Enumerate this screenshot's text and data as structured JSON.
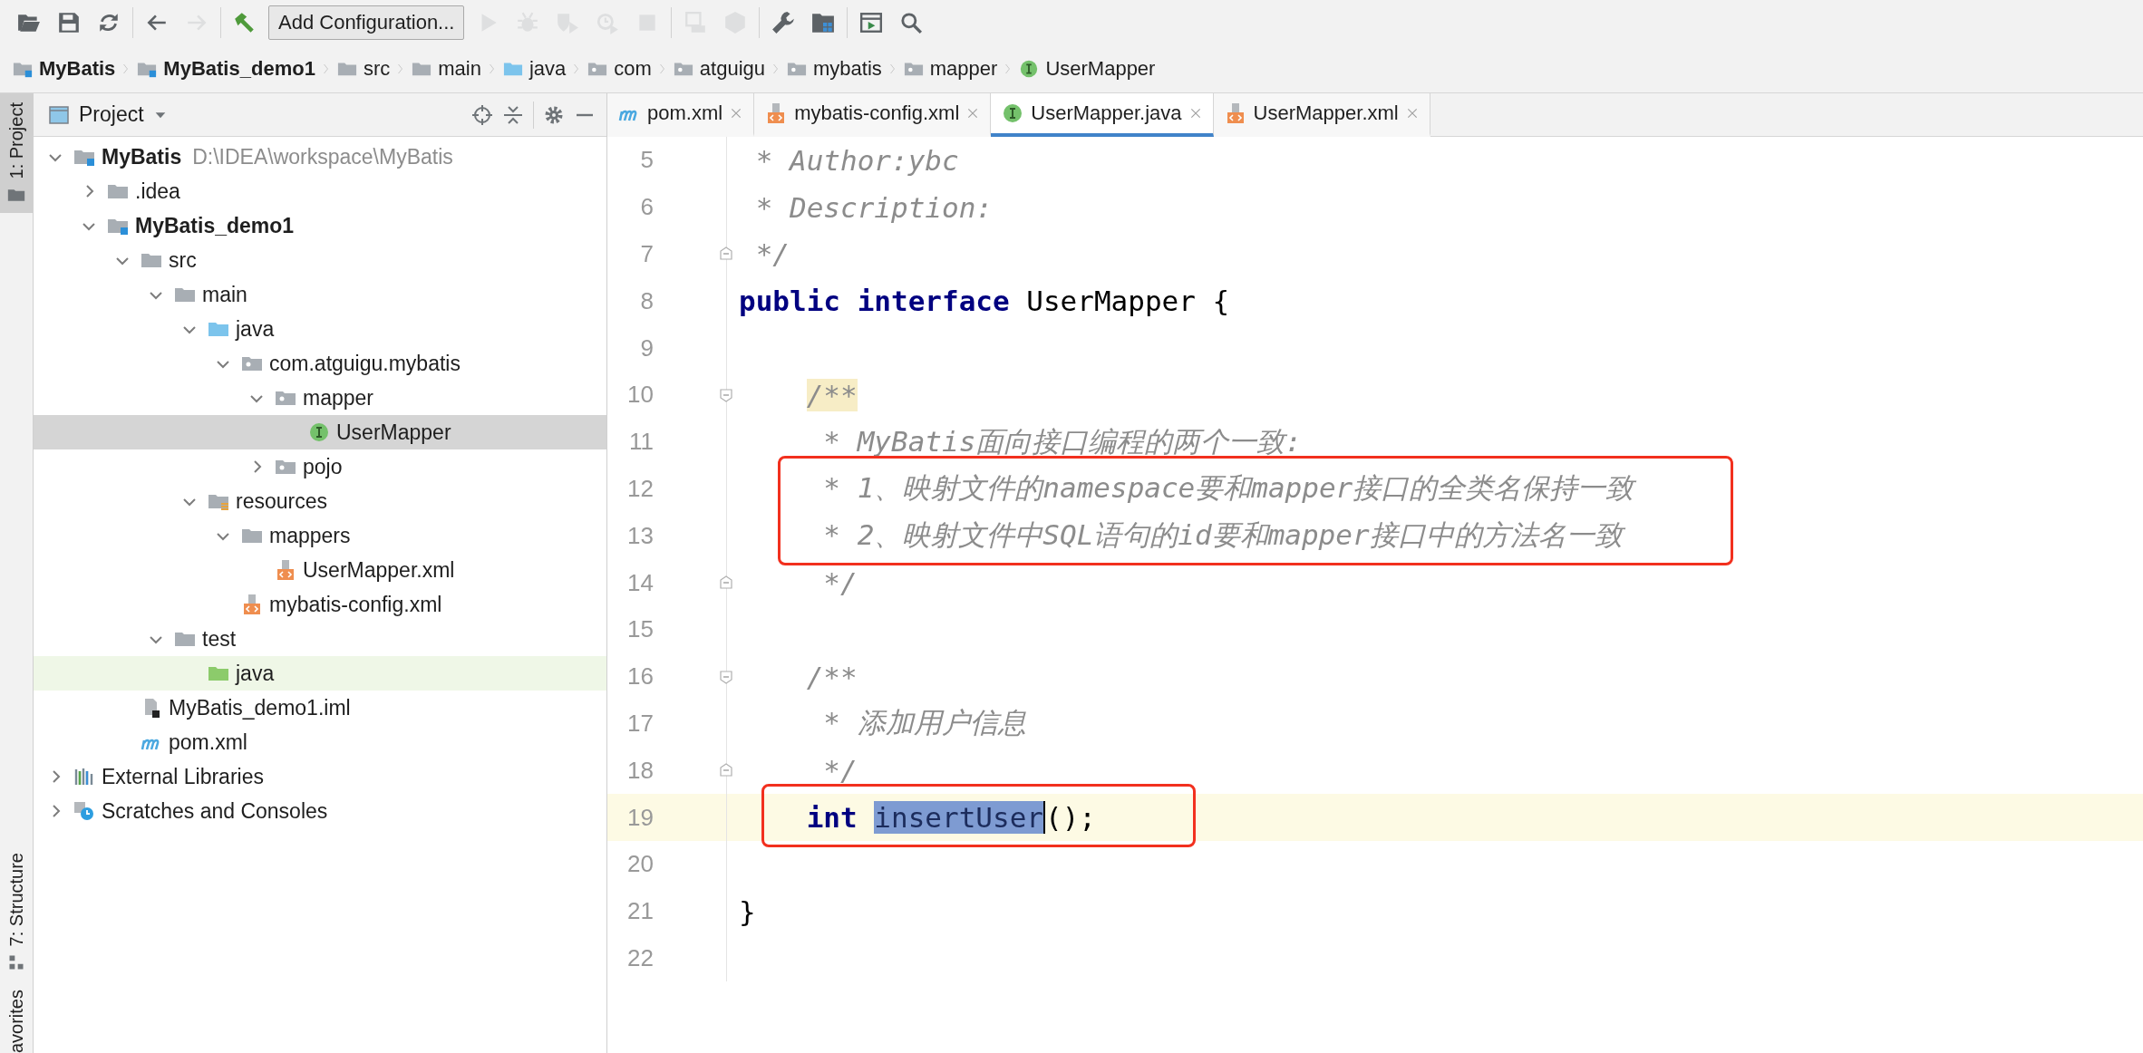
{
  "toolbar": {
    "groups": [
      [
        {
          "kind": "open",
          "disabled": false
        },
        {
          "kind": "save",
          "disabled": false
        },
        {
          "kind": "sync",
          "disabled": false
        }
      ],
      [
        {
          "kind": "back",
          "disabled": false
        },
        {
          "kind": "forward",
          "disabled": true
        }
      ],
      [
        {
          "kind": "build",
          "disabled": false
        },
        {
          "kind": "run_config",
          "label": "Add Configuration...",
          "disabled": false
        },
        {
          "kind": "run",
          "disabled": true
        },
        {
          "kind": "debug",
          "disabled": true
        },
        {
          "kind": "coverage",
          "disabled": true
        },
        {
          "kind": "profile",
          "disabled": true
        },
        {
          "kind": "stop",
          "disabled": true
        }
      ],
      [
        {
          "kind": "attach",
          "disabled": true
        },
        {
          "kind": "deploy",
          "disabled": true
        }
      ],
      [
        {
          "kind": "settings",
          "disabled": false
        },
        {
          "kind": "project_structure",
          "disabled": false
        }
      ],
      [
        {
          "kind": "frame",
          "disabled": false
        },
        {
          "kind": "search",
          "disabled": false
        }
      ]
    ]
  },
  "breadcrumbs": [
    {
      "label": "MyBatis",
      "kind": "module"
    },
    {
      "label": "MyBatis_demo1",
      "kind": "module"
    },
    {
      "label": "src",
      "kind": "folder"
    },
    {
      "label": "main",
      "kind": "folder"
    },
    {
      "label": "java",
      "kind": "source_folder"
    },
    {
      "label": "com",
      "kind": "package"
    },
    {
      "label": "atguigu",
      "kind": "package"
    },
    {
      "label": "mybatis",
      "kind": "package"
    },
    {
      "label": "mapper",
      "kind": "package"
    },
    {
      "label": "UserMapper",
      "kind": "interface"
    }
  ],
  "tool_stripe": [
    {
      "label": "1: Project",
      "kind": "project",
      "selected": true
    },
    {
      "label": "7: Structure",
      "kind": "structure",
      "selected": false
    },
    {
      "label": "avorites",
      "kind": "favorites",
      "selected": false
    }
  ],
  "project_panel": {
    "title": "Project",
    "tree": [
      {
        "label": "MyBatis",
        "path": "D:\\IDEA\\workspace\\MyBatis",
        "kind": "module",
        "expanded": true,
        "selected": false,
        "highlighted": false,
        "children": [
          {
            "label": ".idea",
            "kind": "folder",
            "expanded": false,
            "selected": false,
            "highlighted": false
          },
          {
            "label": "MyBatis_demo1",
            "kind": "module",
            "expanded": true,
            "selected": false,
            "highlighted": false,
            "children": [
              {
                "label": "src",
                "kind": "folder",
                "expanded": true,
                "selected": false,
                "highlighted": false,
                "children": [
                  {
                    "label": "main",
                    "kind": "folder",
                    "expanded": true,
                    "selected": false,
                    "highlighted": false,
                    "children": [
                      {
                        "label": "java",
                        "kind": "source_folder",
                        "expanded": true,
                        "selected": false,
                        "highlighted": false,
                        "children": [
                          {
                            "label": "com.atguigu.mybatis",
                            "kind": "package",
                            "expanded": true,
                            "selected": false,
                            "highlighted": false,
                            "children": [
                              {
                                "label": "mapper",
                                "kind": "package",
                                "expanded": true,
                                "selected": false,
                                "highlighted": false,
                                "children": [
                                  {
                                    "label": "UserMapper",
                                    "kind": "interface",
                                    "selected": true,
                                    "highlighted": false
                                  }
                                ]
                              },
                              {
                                "label": "pojo",
                                "kind": "package",
                                "expanded": false,
                                "selected": false,
                                "highlighted": false
                              }
                            ]
                          }
                        ]
                      },
                      {
                        "label": "resources",
                        "kind": "resources",
                        "expanded": true,
                        "selected": false,
                        "highlighted": false,
                        "children": [
                          {
                            "label": "mappers",
                            "kind": "folder",
                            "expanded": true,
                            "selected": false,
                            "highlighted": false,
                            "children": [
                              {
                                "label": "UserMapper.xml",
                                "kind": "xml",
                                "selected": false,
                                "highlighted": false
                              }
                            ]
                          },
                          {
                            "label": "mybatis-config.xml",
                            "kind": "xml",
                            "selected": false,
                            "highlighted": false
                          }
                        ]
                      }
                    ]
                  },
                  {
                    "label": "test",
                    "kind": "folder",
                    "expanded": true,
                    "selected": false,
                    "highlighted": false,
                    "children": [
                      {
                        "label": "java",
                        "kind": "test_folder",
                        "selected": false,
                        "highlighted": true
                      }
                    ]
                  }
                ]
              },
              {
                "label": "MyBatis_demo1.iml",
                "kind": "iml",
                "selected": false,
                "highlighted": false
              },
              {
                "label": "pom.xml",
                "kind": "maven",
                "selected": false,
                "highlighted": false
              }
            ]
          }
        ]
      },
      {
        "label": "External Libraries",
        "kind": "libraries",
        "expanded": false,
        "selected": false,
        "highlighted": false
      },
      {
        "label": "Scratches and Consoles",
        "kind": "scratches",
        "expanded": false,
        "selected": false,
        "highlighted": false
      }
    ]
  },
  "editor": {
    "tabs": [
      {
        "label": "pom.xml",
        "kind": "maven",
        "selected": false
      },
      {
        "label": "mybatis-config.xml",
        "kind": "xml",
        "selected": false
      },
      {
        "label": "UserMapper.java",
        "kind": "interface",
        "selected": true
      },
      {
        "label": "UserMapper.xml",
        "kind": "xml",
        "selected": false
      }
    ],
    "lines": [
      {
        "number": "5",
        "fold_start": false,
        "fold_end": false,
        "current": false,
        "boxed": false,
        "tokens": [
          {
            "kind": "comment",
            "text": " * Author:ybc"
          }
        ]
      },
      {
        "number": "6",
        "fold_start": false,
        "fold_end": false,
        "current": false,
        "boxed": false,
        "tokens": [
          {
            "kind": "comment",
            "text": " * Description:"
          }
        ]
      },
      {
        "number": "7",
        "fold_start": false,
        "fold_end": true,
        "current": false,
        "boxed": false,
        "tokens": [
          {
            "kind": "comment",
            "text": " */"
          }
        ]
      },
      {
        "number": "8",
        "fold_start": false,
        "fold_end": false,
        "current": false,
        "boxed": false,
        "tokens": [
          {
            "kind": "keyword",
            "text": "public"
          },
          {
            "kind": "keyword",
            "text": " interface"
          },
          {
            "kind": "plain",
            "text": " UserMapper {"
          }
        ]
      },
      {
        "number": "9",
        "fold_start": false,
        "fold_end": false,
        "current": false,
        "boxed": false
      },
      {
        "number": "10",
        "fold_start": true,
        "fold_end": false,
        "current": false,
        "boxed": false,
        "tokens": [
          {
            "kind": "comment_match",
            "text": "    /**"
          }
        ]
      },
      {
        "number": "11",
        "fold_start": false,
        "fold_end": false,
        "current": false,
        "boxed": false,
        "tokens": [
          {
            "kind": "comment",
            "text": "     * MyBatis面向接口编程的两个一致:"
          }
        ]
      },
      {
        "number": "12",
        "fold_start": false,
        "fold_end": false,
        "current": false,
        "boxed": true,
        "tokens": [
          {
            "kind": "comment",
            "text": "     * 1、映射文件的namespace要和mapper接口的全类名保持一致"
          }
        ]
      },
      {
        "number": "13",
        "fold_start": false,
        "fold_end": false,
        "current": false,
        "boxed": true,
        "tokens": [
          {
            "kind": "comment",
            "text": "     * 2、映射文件中SQL语句的id要和mapper接口中的方法名一致"
          }
        ]
      },
      {
        "number": "14",
        "fold_start": false,
        "fold_end": true,
        "current": false,
        "boxed": false,
        "tokens": [
          {
            "kind": "comment",
            "text": "     */"
          }
        ]
      },
      {
        "number": "15",
        "fold_start": false,
        "fold_end": false,
        "current": false,
        "boxed": false
      },
      {
        "number": "16",
        "fold_start": true,
        "fold_end": false,
        "current": false,
        "boxed": false,
        "tokens": [
          {
            "kind": "comment",
            "text": "    /**"
          }
        ]
      },
      {
        "number": "17",
        "fold_start": false,
        "fold_end": false,
        "current": false,
        "boxed": false,
        "tokens": [
          {
            "kind": "comment",
            "text": "     * 添加用户信息"
          }
        ]
      },
      {
        "number": "18",
        "fold_start": false,
        "fold_end": true,
        "current": false,
        "boxed": false,
        "tokens": [
          {
            "kind": "comment",
            "text": "     */"
          }
        ]
      },
      {
        "number": "19",
        "fold_start": false,
        "fold_end": false,
        "current": true,
        "boxed": true,
        "tokens": [
          {
            "kind": "keyword",
            "text": "    int"
          },
          {
            "kind": "selection",
            "text": " insertUser",
            "caret": true
          },
          {
            "kind": "plain",
            "text": "();"
          }
        ]
      },
      {
        "number": "20",
        "fold_start": false,
        "fold_end": false,
        "current": false,
        "boxed": false
      },
      {
        "number": "21",
        "fold_start": false,
        "fold_end": false,
        "current": false,
        "boxed": false,
        "tokens": [
          {
            "kind": "plain",
            "text": "}"
          }
        ]
      },
      {
        "number": "22",
        "fold_start": false,
        "fold_end": false,
        "current": false,
        "boxed": false
      }
    ]
  }
}
